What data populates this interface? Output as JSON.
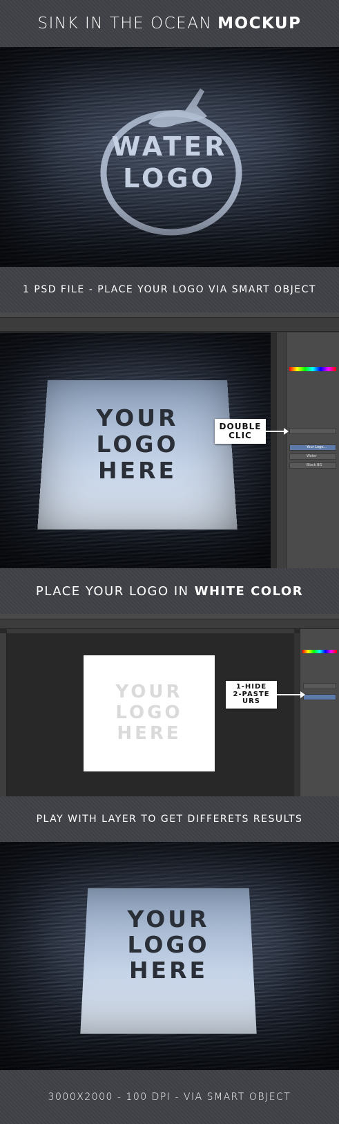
{
  "header": {
    "title_light": "SINK IN THE OCEAN",
    "title_bold": "MOCKUP"
  },
  "hero": {
    "logo_line1": "WATER",
    "logo_line2": "LOGO"
  },
  "section1": {
    "caption": "1 PSD FILE - PLACE YOUR LOGO VIA SMART OBJECT"
  },
  "ps1": {
    "paper_lines": [
      "YOUR",
      "LOGO",
      "HERE"
    ],
    "callout_line1": "DOUBLE",
    "callout_line2": "CLIC",
    "layers": [
      "Your Logo...",
      "Water",
      "Black BG"
    ]
  },
  "section2": {
    "caption_light": "PLACE YOUR LOGO IN",
    "caption_bold": "WHITE COLOR"
  },
  "ps2": {
    "paper_lines": [
      "YOUR",
      "LOGO",
      "HERE"
    ],
    "callout_line1": "1-HIDE",
    "callout_line2": "2-PASTE URS"
  },
  "section3": {
    "caption": "PLAY WITH LAYER TO GET DIFFERETS RESULTS"
  },
  "result": {
    "paper_lines": [
      "YOUR",
      "LOGO",
      "HERE"
    ]
  },
  "footer": {
    "caption": "3000X2000 - 100 DPI - VIA SMART OBJECT"
  },
  "colors": {
    "band": "#45464b",
    "ocean": "#1b2230",
    "paper": "#c9d6e8",
    "ps_gray": "#3a3a3a",
    "accent_blue": "#5d7aa8"
  }
}
